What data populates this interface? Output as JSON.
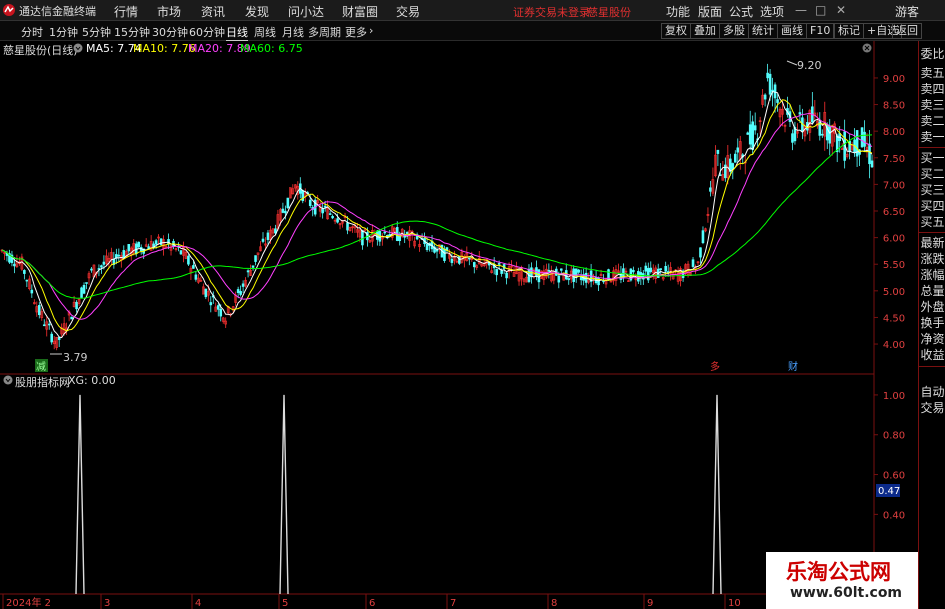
{
  "app": {
    "title": "通达信金融终端"
  },
  "menu": [
    "行情",
    "市场",
    "资讯",
    "发现",
    "问小达",
    "财富圈",
    "交易"
  ],
  "notice": {
    "trade_status": "证券交易未登录",
    "stock": "慈星股份"
  },
  "menu_right": [
    "功能",
    "版面",
    "公式",
    "选项"
  ],
  "window_controls": {
    "minimize": "—",
    "restore": "□",
    "close": "✕"
  },
  "user": "游客",
  "periods": [
    "分时",
    "1分钟",
    "5分钟",
    "15分钟",
    "30分钟",
    "60分钟",
    "日线",
    "周线",
    "月线",
    "多周期",
    "更多"
  ],
  "active_period": "日线",
  "more_arrow": "›",
  "toolbar_right": [
    "复权",
    "叠加",
    "多股",
    "统计",
    "画线",
    "F10",
    "标记",
    "+自选",
    "返回"
  ],
  "chart_title": "慈星股份(日线)",
  "ma": [
    {
      "label": "MA5: 7.74",
      "color": "#ffffff"
    },
    {
      "label": "MA10: 7.76",
      "color": "#ffff00"
    },
    {
      "label": "MA20: 7.89",
      "color": "#ff40ff"
    },
    {
      "label": "MA60: 6.75",
      "color": "#00ff00"
    }
  ],
  "indicator": {
    "name": "股朋指标网",
    "value": "XG: 0.00"
  },
  "side_panel": [
    "委比",
    "卖五",
    "卖四",
    "卖三",
    "卖二",
    "卖一",
    "买一",
    "买二",
    "买三",
    "买四",
    "买五",
    "最新",
    "涨跌",
    "涨幅",
    "总量",
    "外盘",
    "换手",
    "净资",
    "收益",
    "自动",
    "交易"
  ],
  "markers": {
    "low_label": "3.79",
    "high_label": "9.20",
    "event1": "减",
    "event2": "多",
    "event3": "财"
  },
  "current_indicator_value": "0.47",
  "watermark": {
    "title": "乐淘公式网",
    "url": "www.60lt.com"
  },
  "colors": {
    "up": "#ff3232",
    "down": "#54ffff",
    "ma5": "#ffffff",
    "ma10": "#ffff00",
    "ma20": "#ff40ff",
    "ma60": "#00ff00",
    "frame": "#7a1010"
  },
  "chart_data": [
    {
      "type": "candlestick",
      "title": "慈星股份(日线)",
      "y_ticks": [
        "9.00",
        "8.50",
        "8.00",
        "7.50",
        "7.00",
        "6.50",
        "6.00",
        "5.50",
        "5.00",
        "4.50",
        "4.00"
      ],
      "ylim": [
        3.55,
        9.45
      ],
      "x_ticks": [
        "2024年 2",
        "3",
        "4",
        "5",
        "6",
        "7",
        "8",
        "9",
        "10"
      ],
      "ma_values": {
        "MA5": 7.74,
        "MA10": 7.76,
        "MA20": 7.89,
        "MA60": 6.75
      },
      "low": 3.79,
      "high": 9.2
    },
    {
      "type": "line",
      "title": "股朋指标网",
      "series": [
        {
          "name": "XG",
          "values": [
            1,
            1,
            1
          ]
        }
      ],
      "y_ticks": [
        "1.00",
        "0.80",
        "0.60",
        "0.40"
      ],
      "ylim": [
        0,
        1.08
      ],
      "current": 0.47
    }
  ]
}
